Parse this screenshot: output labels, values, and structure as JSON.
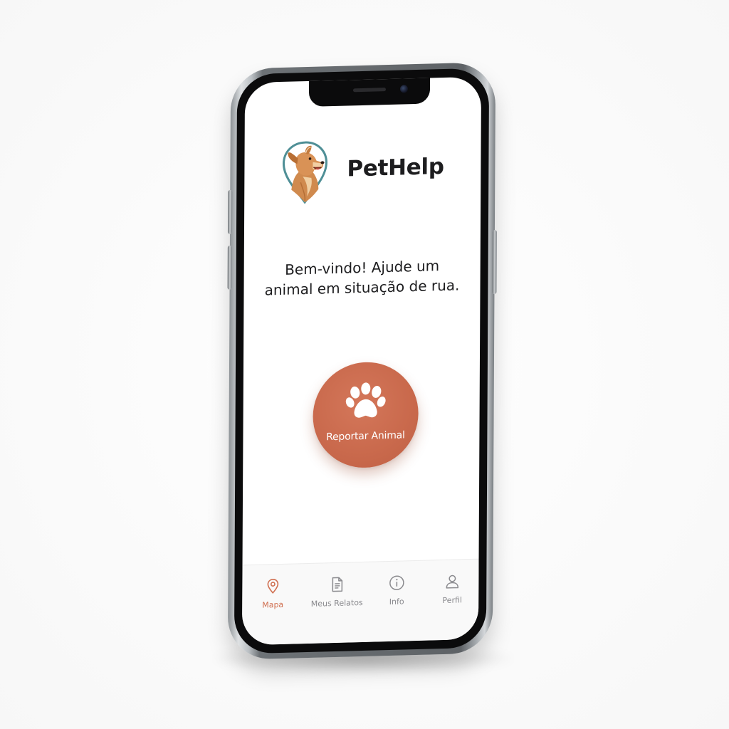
{
  "app": {
    "title": "PetHelp",
    "logo_icon": "dog-location-pin-icon"
  },
  "home": {
    "welcome_message": "Bem-vindo! Ajude um animal em situação de rua.",
    "report_button": {
      "label": "Reportar Animal",
      "icon": "paw-icon"
    }
  },
  "tabbar": {
    "active_tab": "Mapa",
    "items": [
      {
        "label": "Mapa",
        "icon": "map-pin-icon"
      },
      {
        "label": "Meus Relatos",
        "icon": "document-icon"
      },
      {
        "label": "Info",
        "icon": "info-icon"
      },
      {
        "label": "Perfil",
        "icon": "user-icon"
      }
    ]
  },
  "colors": {
    "accent": "#d06f50",
    "text_primary": "#1d1d1f",
    "tab_inactive": "#8a8a8e",
    "logo_teal": "#4f8f96"
  }
}
